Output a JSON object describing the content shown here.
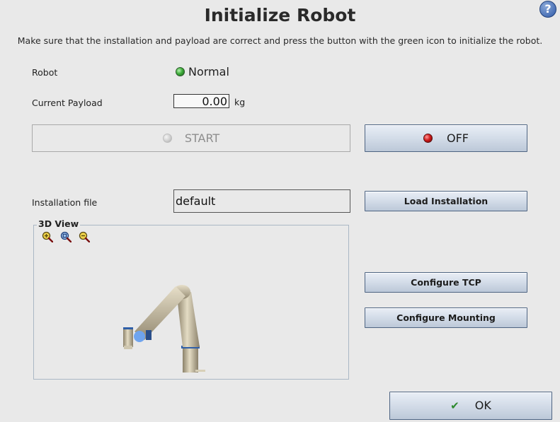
{
  "window": {
    "title": "Initialize Robot"
  },
  "help": {
    "label": "?"
  },
  "instructions": "Make sure that the installation and payload are correct and press the button with the green icon to initialize the robot.",
  "robot": {
    "label": "Robot",
    "status": "Normal",
    "status_color": "#3fae3b"
  },
  "payload": {
    "label": "Current Payload",
    "value": "0.00",
    "unit": "kg"
  },
  "buttons": {
    "start": "START",
    "off": "OFF",
    "load_installation": "Load Installation",
    "configure_tcp": "Configure TCP",
    "configure_mounting": "Configure Mounting",
    "ok": "OK"
  },
  "installation": {
    "label": "Installation file",
    "value": "default"
  },
  "view3d": {
    "title": "3D View",
    "tools": [
      "zoom-in-icon",
      "zoom-fit-icon",
      "zoom-out-icon"
    ]
  },
  "colors": {
    "accent": "#4e6482",
    "off_led": "#d21d1d",
    "ok_check": "#2e8a2e"
  }
}
